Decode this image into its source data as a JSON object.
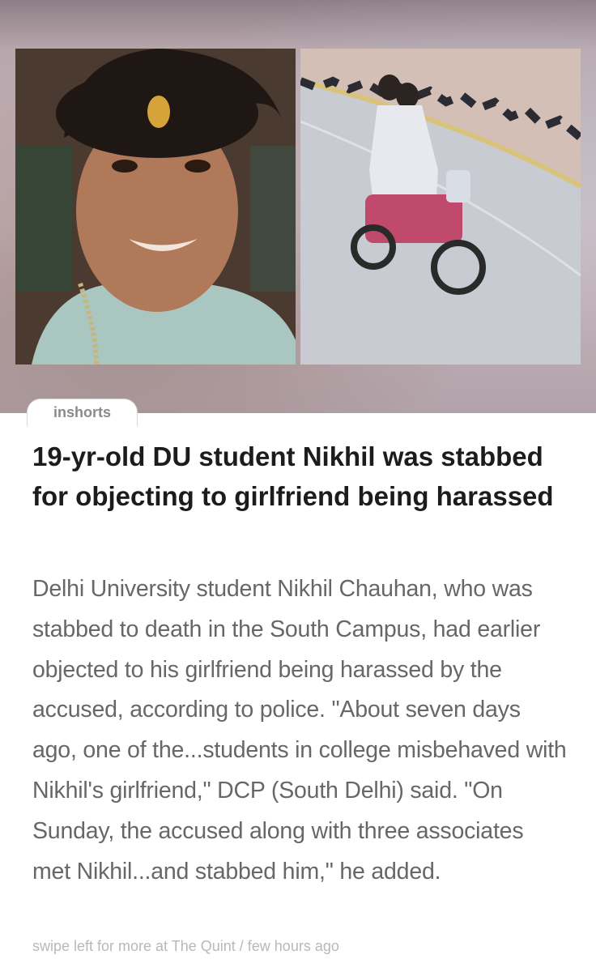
{
  "source": {
    "brand": "inshorts"
  },
  "article": {
    "headline": "19-yr-old DU student Nikhil was stabbed for objecting to girlfriend being harassed",
    "body": "Delhi University student Nikhil Chauhan, who was stabbed to death in the South Campus, had earlier objected to his girlfriend being harassed by the accused, according to police. \"About seven days ago, one of the...students in college misbehaved with Nikhil's girlfriend,\" DCP (South Delhi) said. \"On Sunday, the accused along with three associates met Nikhil...and stabbed him,\" he added.",
    "footer": "swipe left for more at The Quint / few hours ago"
  },
  "images": {
    "left": "portrait-photo",
    "right": "motorcycle-riders-photo"
  },
  "colors": {
    "headline": "#1c1c1c",
    "body": "#676767",
    "footer": "#b8b8b8",
    "source_tab_text": "#8a8a8a"
  }
}
